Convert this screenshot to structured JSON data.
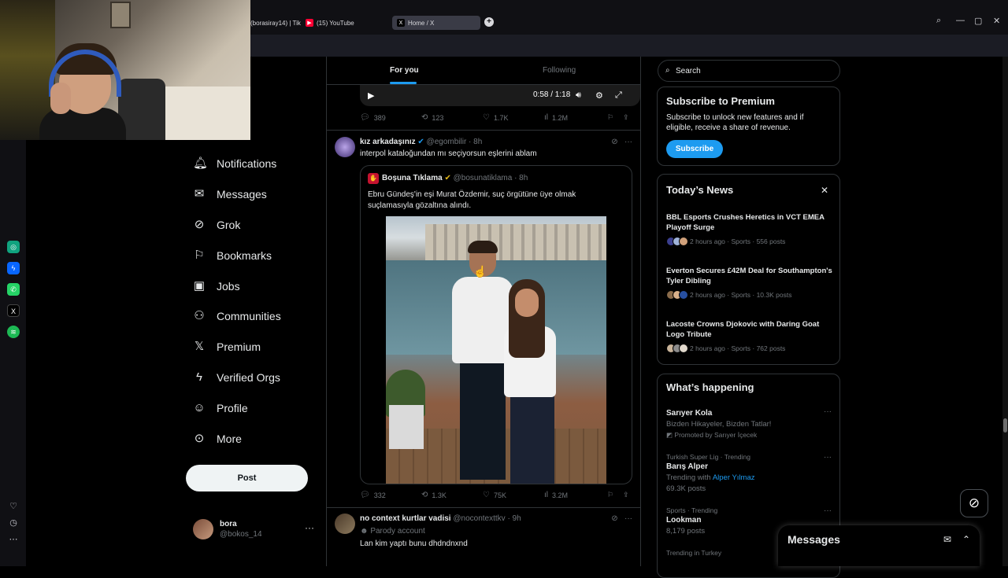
{
  "browser": {
    "tabs": [
      {
        "label": "(borasiray14) | Tik",
        "icon": "tiktok-icon"
      },
      {
        "label": "(15) YouTube",
        "icon": "youtube-icon"
      },
      {
        "label": "Home / X",
        "icon": "x-icon"
      }
    ],
    "new_tab": "+",
    "window_controls": {
      "search": "⌕",
      "minimize": "—",
      "maximize": "▢",
      "close": "✕"
    },
    "accent": "#3a3b46"
  },
  "sidebar_apps": [
    "chatgpt-icon",
    "messenger-icon",
    "whatsapp-icon",
    "x-icon",
    "spotify-icon"
  ],
  "nav": {
    "items": [
      {
        "label": "Notifications",
        "icon": "bell-icon",
        "glyph": "🔔︎"
      },
      {
        "label": "Messages",
        "icon": "envelope-icon",
        "glyph": "✉︎"
      },
      {
        "label": "Grok",
        "icon": "grok-icon",
        "glyph": "⊘"
      },
      {
        "label": "Bookmarks",
        "icon": "bookmark-icon",
        "glyph": "⚐"
      },
      {
        "label": "Jobs",
        "icon": "briefcase-icon",
        "glyph": "▣"
      },
      {
        "label": "Communities",
        "icon": "communities-icon",
        "glyph": "⚇"
      },
      {
        "label": "Premium",
        "icon": "x-logo-icon",
        "glyph": "𝕏"
      },
      {
        "label": "Verified Orgs",
        "icon": "lightning-icon",
        "glyph": "ϟ"
      },
      {
        "label": "Profile",
        "icon": "person-icon",
        "glyph": "☺"
      },
      {
        "label": "More",
        "icon": "more-circle-icon",
        "glyph": "⊙"
      }
    ],
    "post_label": "Post",
    "account": {
      "name": "bora",
      "handle": "@bokos_14",
      "more": "···"
    }
  },
  "timeline": {
    "tabs": {
      "for_you": "For you",
      "following": "Following"
    },
    "video": {
      "time": "0:58 / 1:18",
      "play": "▶",
      "mute": "🔊︎",
      "settings": "⚙",
      "fullscreen": "⤢"
    },
    "video_stats": {
      "replies": "389",
      "reposts": "123",
      "likes": "1.7K",
      "views": "1.2M"
    },
    "tweet1": {
      "name": "kız arkadaşınız",
      "handle": "@egombilir · 8h",
      "text": "interpol kataloğundan mı seçiyorsun eşlerini ablam",
      "quote": {
        "name": "Boşuna Tıklama",
        "handle": "@bosunatiklama · 8h",
        "text": "Ebru Gündeş'in eşi Murat Özdemir, suç örgütüne üye olmak suçlamasıyla gözaltına alındı."
      },
      "stats": {
        "replies": "332",
        "reposts": "1.3K",
        "likes": "75K",
        "views": "3.2M"
      }
    },
    "tweet2": {
      "name": "no context kurtlar vadisi",
      "handle": "@nocontexttkv · 9h",
      "badge": "Parody account",
      "text": "Lan kim yaptı bunu dhdndnxnd"
    }
  },
  "right": {
    "search_placeholder": "Search",
    "premium": {
      "title": "Subscribe to Premium",
      "text": "Subscribe to unlock new features and if eligible, receive a share of revenue.",
      "button": "Subscribe"
    },
    "news": {
      "title": "Today’s News",
      "items": [
        {
          "title": "BBL Esports Crushes Heretics in VCT EMEA Playoff Surge",
          "meta": "2 hours ago · Sports · 556 posts"
        },
        {
          "title": "Everton Secures £42M Deal for Southampton's Tyler Dibling",
          "meta": "2 hours ago · Sports · 10.3K posts"
        },
        {
          "title": "Lacoste Crowns Djokovic with Daring Goat Logo Tribute",
          "meta": "2 hours ago · Sports · 762 posts"
        }
      ]
    },
    "happening": {
      "title": "What’s happening",
      "trends": [
        {
          "context": "",
          "name": "Sarıyer Kola",
          "sub": "Bizden Hikayeler, Bizden Tatlar!",
          "promo": "Promoted by Sarıyer İçecek"
        },
        {
          "context": "Turkish Super Lig · Trending",
          "name": "Barış Alper",
          "sub_prefix": "Trending with",
          "sub_link": "Alper Yılmaz",
          "count": "69.3K posts"
        },
        {
          "context": "Sports · Trending",
          "name": "Lookman",
          "count": "8,179 posts"
        },
        {
          "context": "Trending in Turkey",
          "name": ""
        }
      ]
    }
  },
  "messages_drawer": {
    "title": "Messages"
  },
  "colors": {
    "accent": "#1d9bf0",
    "background": "#000000",
    "border": "#2f3336",
    "muted": "#71767b"
  }
}
